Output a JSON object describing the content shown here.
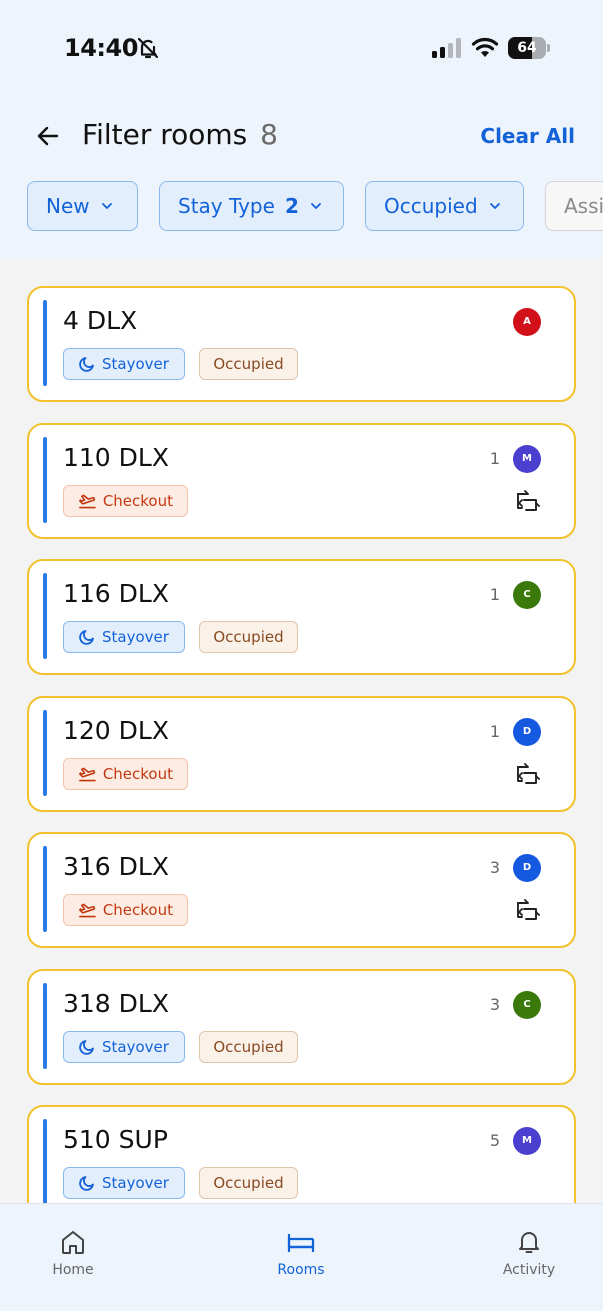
{
  "status_bar": {
    "time": "14:40",
    "battery": "64",
    "battery_level": 0.64
  },
  "header": {
    "title": "Filter rooms",
    "count": "8",
    "clear_all": "Clear All"
  },
  "filters": [
    {
      "label": "New",
      "count": ""
    },
    {
      "label": "Stay Type",
      "count": "2"
    },
    {
      "label": "Occupied",
      "count": ""
    },
    {
      "label": "Assi",
      "count": ""
    }
  ],
  "rooms": [
    {
      "name": "4 DLX",
      "tag": "Stayover",
      "status": "Occupied",
      "count": "",
      "avatar": "A",
      "avatar_color": "#d2101a",
      "swap": false
    },
    {
      "name": "110 DLX",
      "tag": "Checkout",
      "status": "",
      "count": "1",
      "avatar": "M",
      "avatar_color": "#4a3fcf",
      "swap": true
    },
    {
      "name": "116 DLX",
      "tag": "Stayover",
      "status": "Occupied",
      "count": "1",
      "avatar": "C",
      "avatar_color": "#3b7a0a",
      "swap": false
    },
    {
      "name": "120 DLX",
      "tag": "Checkout",
      "status": "",
      "count": "1",
      "avatar": "D",
      "avatar_color": "#1559e0",
      "swap": true
    },
    {
      "name": "316 DLX",
      "tag": "Checkout",
      "status": "",
      "count": "3",
      "avatar": "D",
      "avatar_color": "#1559e0",
      "swap": true
    },
    {
      "name": "318 DLX",
      "tag": "Stayover",
      "status": "Occupied",
      "count": "3",
      "avatar": "C",
      "avatar_color": "#3b7a0a",
      "swap": false
    },
    {
      "name": "510 SUP",
      "tag": "Stayover",
      "status": "Occupied",
      "count": "5",
      "avatar": "M",
      "avatar_color": "#4a3fcf",
      "swap": false
    }
  ],
  "nav": [
    {
      "label": "Home",
      "icon": "home-icon",
      "active": false
    },
    {
      "label": "Rooms",
      "icon": "bed-icon",
      "active": true
    },
    {
      "label": "Activity",
      "icon": "bell-icon",
      "active": false
    }
  ],
  "colors": {
    "accent": "#1462d8",
    "card_border": "#f2c12c",
    "header_bg": "#edf4fc"
  }
}
